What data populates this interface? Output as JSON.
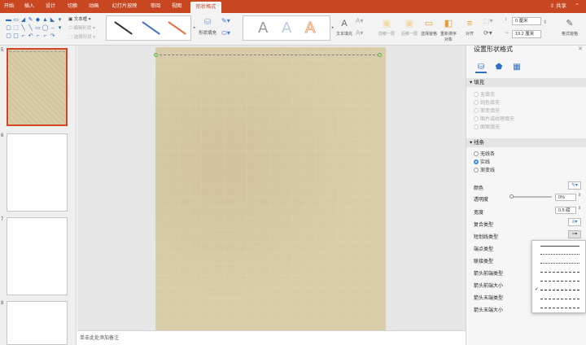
{
  "tabs": [
    {
      "label": "开始"
    },
    {
      "label": "插入"
    },
    {
      "label": "设计"
    },
    {
      "label": "切换"
    },
    {
      "label": "动画"
    },
    {
      "label": "幻灯片放映"
    },
    {
      "label": "审阅"
    },
    {
      "label": "视图"
    },
    {
      "label": "形状格式"
    }
  ],
  "share_label": "共享",
  "ribbon": {
    "text_box": "文本框",
    "edit_shape": "编辑形状",
    "select_shape": "选择形状",
    "shape_fill": "形状填充",
    "text_fill": "文本填充",
    "forward": "前移一层",
    "backward": "后移一层",
    "selection_pane": "选择窗格",
    "reorder": "重新排序对象",
    "align": "对齐",
    "height": "0 厘米",
    "width": "19.2 厘米",
    "format_pane": "格式窗格",
    "wordart": [
      "A",
      "A",
      "A"
    ]
  },
  "slides": [
    {
      "num": "5"
    },
    {
      "num": "6"
    },
    {
      "num": "7"
    },
    {
      "num": "8"
    }
  ],
  "notes_placeholder": "单击此处添加备注",
  "pane": {
    "title": "设置形状格式",
    "fill_header": "填充",
    "fill_options": [
      "无填充",
      "纯色填充",
      "渐变填充",
      "图片或纹理填充",
      "图案填充"
    ],
    "line_header": "线条",
    "line_options": [
      "无线条",
      "实线",
      "渐变线"
    ],
    "color_label": "颜色",
    "transparency_label": "透明度",
    "transparency_value": "0%",
    "width_label": "宽度",
    "width_value": "0.5 磅",
    "compound_label": "复合类型",
    "dash_label": "短划线类型",
    "cap_label": "端点类型",
    "join_label": "联接类型",
    "begin_arrow_type": "箭头前端类型",
    "begin_arrow_size": "箭头前端大小",
    "end_arrow_type": "箭头末端类型",
    "end_arrow_size": "箭头末端大小"
  },
  "colors": {
    "accent": "#c84720",
    "selected_border": "#d24726",
    "slide_bg": "#d9cca9",
    "radio_on": "#3a8ee6"
  }
}
